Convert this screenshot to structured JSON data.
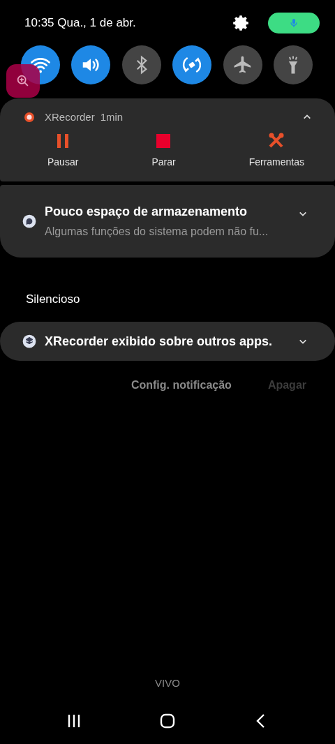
{
  "status": {
    "datetime": "10:35 Qua., 1 de abr.",
    "mic_active": true
  },
  "quick_tiles": [
    {
      "kind": "wifi",
      "on": true
    },
    {
      "kind": "sound",
      "on": true
    },
    {
      "kind": "bluetooth",
      "on": false
    },
    {
      "kind": "rotate",
      "on": true
    },
    {
      "kind": "airplane",
      "on": false
    },
    {
      "kind": "flashlight",
      "on": false
    }
  ],
  "floating_button": {
    "kind": "zoom"
  },
  "notifications": [
    {
      "kind": "media",
      "app": "XRecorder",
      "time": "1min",
      "expanded": true,
      "actions": [
        {
          "kind": "pause",
          "label": "Pausar"
        },
        {
          "kind": "stop",
          "label": "Parar"
        },
        {
          "kind": "tools",
          "label": "Ferramentas"
        }
      ]
    },
    {
      "kind": "message",
      "title": "Pouco espaço de armazenamento",
      "text": "Algumas funções do sistema podem não fu...",
      "expanded": false
    }
  ],
  "silent_section": {
    "heading": "Silencioso",
    "notifications": [
      {
        "kind": "overlay",
        "title": "XRecorder exibido sobre outros apps.",
        "expanded": false
      }
    ]
  },
  "footer_actions": [
    {
      "label": "Config. notificação",
      "disabled": false
    },
    {
      "label": "Apagar",
      "disabled": true
    }
  ],
  "carrier": "VIVO",
  "nav_bar": [
    {
      "kind": "recents"
    },
    {
      "kind": "home"
    },
    {
      "kind": "back"
    }
  ]
}
